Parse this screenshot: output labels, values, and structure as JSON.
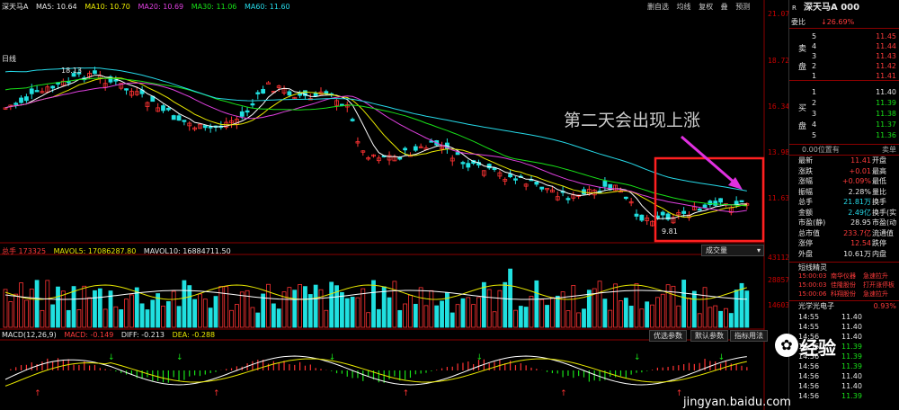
{
  "stock": {
    "name": "深天马A",
    "top_legend": {
      "name": "深天马A",
      "ma5": "MA5: 10.64",
      "ma10": "MA10: 10.70",
      "ma20": "MA20: 10.69",
      "ma30": "MA30: 11.06",
      "ma60": "MA60: 11.60"
    }
  },
  "toolbar": {
    "items": [
      "删自选",
      "均线",
      "复权",
      "叠",
      "预测"
    ]
  },
  "price_axis": [
    "21.07",
    "18.72",
    "16.34",
    "13.98",
    "11.63"
  ],
  "chart_labels": {
    "day_label": "日线",
    "high": "18.13",
    "low": "9.81"
  },
  "annotation": {
    "text": "第二天会出现上涨",
    "color": "#e030e0"
  },
  "volume_legend": {
    "total": "总手 173325",
    "mavol5": "MAVOL5: 17086287.80",
    "mavol10": "MAVOL10: 16884711.50"
  },
  "volume_axis": [
    "43112",
    "28857",
    "14603"
  ],
  "volume_selector": "成交量",
  "macd_legend": {
    "title": "MACD(12,26,9)",
    "macd": "MACD: -0.149",
    "diff": "DIFF: -0.213",
    "dea": "DEA: -0.288"
  },
  "macd_buttons": [
    "优选参数",
    "默认参数",
    "指标用法"
  ],
  "quote": {
    "header_tag": "R",
    "header_name": "深天马A 000",
    "commission_label": "委比",
    "commission_value": "↓26.69%",
    "sell_rows": [
      {
        "level": "5",
        "price": "11.45"
      },
      {
        "level": "4",
        "price": "11.44"
      },
      {
        "level": "3",
        "price": "11.43"
      },
      {
        "level": "2",
        "price": "11.42"
      },
      {
        "level": "1",
        "price": "11.41"
      }
    ],
    "sell_label": [
      "卖",
      "盘"
    ],
    "buy_rows": [
      {
        "level": "1",
        "price": "11.40"
      },
      {
        "level": "2",
        "price": "11.39"
      },
      {
        "level": "3",
        "price": "11.38"
      },
      {
        "level": "4",
        "price": "11.37"
      },
      {
        "level": "5",
        "price": "11.36"
      }
    ],
    "buy_label": [
      "买",
      "盘"
    ],
    "summary_bar": {
      "left": "0.00位置有",
      "right": "卖单"
    },
    "stats": [
      {
        "label": "最新",
        "value": "11.41",
        "label2": "开盘"
      },
      {
        "label": "涨跌",
        "value": "+0.01",
        "label2": "最高"
      },
      {
        "label": "涨幅",
        "value": "+0.09%",
        "label2": "最低"
      },
      {
        "label": "振幅",
        "value": "2.28%",
        "label2": "量比"
      },
      {
        "label": "总手",
        "value": "21.81万",
        "label2": "换手"
      },
      {
        "label": "金额",
        "value": "2.49亿",
        "label2": "换手(实"
      },
      {
        "label": "市盈(静)",
        "value": "28.95",
        "label2": "市盈(动"
      },
      {
        "label": "总市值",
        "value": "233.7亿",
        "label2": "流通值"
      },
      {
        "label": "涨停",
        "value": "12.54",
        "label2": "跌停"
      },
      {
        "label": "外盘",
        "value": "10.61万",
        "label2": "内盘"
      }
    ],
    "news_title": "短线精灵",
    "news": [
      {
        "time": "15:00:03",
        "name": "南华仪器",
        "event": "急速拉升"
      },
      {
        "time": "15:00:03",
        "name": "佳隆股份",
        "event": "打开涨停板"
      },
      {
        "time": "15:00:06",
        "name": "科翔股份",
        "event": "急速拉升"
      }
    ],
    "sector": {
      "name": "光学光电子",
      "change": "0.93%"
    },
    "ticks": [
      {
        "time": "14:55",
        "price": "11.40"
      },
      {
        "time": "14:55",
        "price": "11.40"
      },
      {
        "time": "14:56",
        "price": "11.40"
      },
      {
        "time": "14:56",
        "price": "11.39"
      },
      {
        "time": "14:56",
        "price": "11.39"
      },
      {
        "time": "14:56",
        "price": "11.39"
      },
      {
        "time": "14:56",
        "price": "11.40"
      },
      {
        "time": "14:56",
        "price": "11.40"
      },
      {
        "time": "14:56",
        "price": "11.39"
      }
    ]
  },
  "watermark": {
    "brand": "经验",
    "url": "jingyan.baidu.com"
  }
}
